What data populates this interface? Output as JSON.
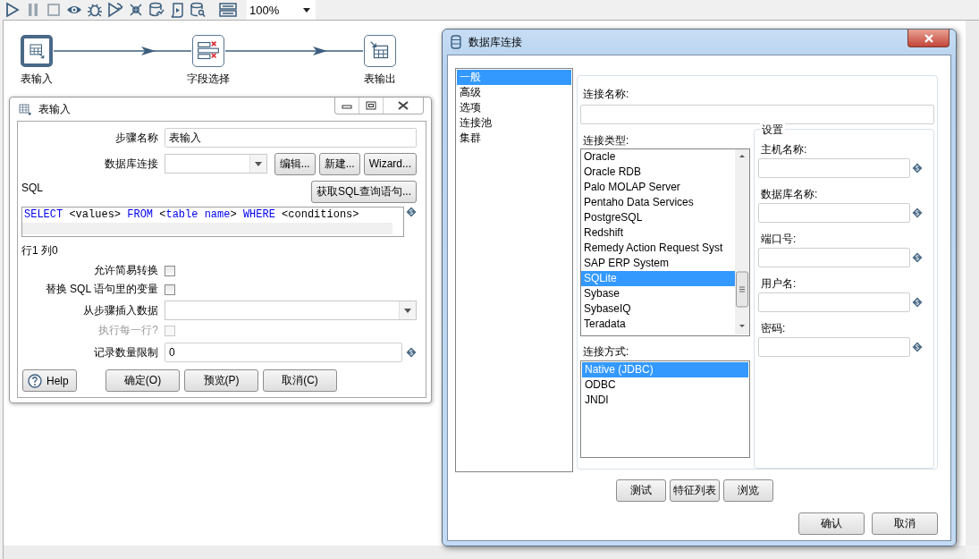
{
  "toolbar": {
    "zoom": "100%"
  },
  "flow": {
    "nodes": [
      {
        "label": "表输入",
        "selected": true,
        "kind": "input"
      },
      {
        "label": "字段选择",
        "selected": false,
        "kind": "select"
      },
      {
        "label": "表输出",
        "selected": false,
        "kind": "output"
      }
    ]
  },
  "step_dialog": {
    "title": "表输入",
    "step_name": {
      "label": "步骤名称",
      "value": "表输入"
    },
    "connection": {
      "label": "数据库连接",
      "buttons": [
        "编辑...",
        "新建...",
        "Wizard..."
      ]
    },
    "sql": {
      "label": "SQL",
      "button": "获取SQL查询语句...",
      "segments": [
        {
          "text": "SELECT",
          "kind": "keyword"
        },
        {
          "text": " <values> ",
          "kind": "plain"
        },
        {
          "text": "FROM",
          "kind": "keyword"
        },
        {
          "text": " <",
          "kind": "plain"
        },
        {
          "text": "table name",
          "kind": "keyword"
        },
        {
          "text": "> ",
          "kind": "plain"
        },
        {
          "text": "WHERE",
          "kind": "keyword"
        },
        {
          "text": " <conditions>",
          "kind": "plain"
        }
      ]
    },
    "position": "行1 列0",
    "options": [
      {
        "label": "允许简易转换",
        "checked": false,
        "disabled": false
      },
      {
        "label": "替换 SQL 语句里的变量",
        "checked": false,
        "disabled": false
      }
    ],
    "insert_from_step": {
      "label": "从步骤插入数据"
    },
    "execute_each_row": {
      "label": "执行每一行?",
      "checked": false,
      "disabled": true
    },
    "limit": {
      "label": "记录数量限制",
      "value": "0"
    },
    "buttons": [
      {
        "label": "Help",
        "kind": "help"
      },
      {
        "label": "确定(O)",
        "kind": "normal"
      },
      {
        "label": "预览(P)",
        "kind": "normal"
      },
      {
        "label": "取消(C)",
        "kind": "normal"
      }
    ]
  },
  "db_dialog": {
    "title": "数据库连接",
    "nav": [
      {
        "label": "一般",
        "selected": true
      },
      {
        "label": "高级",
        "selected": false
      },
      {
        "label": "选项",
        "selected": false
      },
      {
        "label": "连接池",
        "selected": false
      },
      {
        "label": "集群",
        "selected": false
      }
    ],
    "connection_name": {
      "label": "连接名称:"
    },
    "connection_type": {
      "label": "连接类型:",
      "items": [
        {
          "label": "Oracle",
          "selected": false
        },
        {
          "label": "Oracle RDB",
          "selected": false
        },
        {
          "label": "Palo MOLAP Server",
          "selected": false
        },
        {
          "label": "Pentaho Data Services",
          "selected": false
        },
        {
          "label": "PostgreSQL",
          "selected": false
        },
        {
          "label": "Redshift",
          "selected": false
        },
        {
          "label": "Remedy Action Request Syst",
          "selected": false
        },
        {
          "label": "SAP ERP System",
          "selected": false
        },
        {
          "label": "SQLite",
          "selected": true
        },
        {
          "label": "Sybase",
          "selected": false
        },
        {
          "label": "SybaseIQ",
          "selected": false
        },
        {
          "label": "Teradata",
          "selected": false
        }
      ]
    },
    "access": {
      "label": "连接方式:",
      "items": [
        {
          "label": "Native (JDBC)",
          "selected": true
        },
        {
          "label": "ODBC",
          "selected": false
        },
        {
          "label": "JNDI",
          "selected": false
        }
      ]
    },
    "settings": {
      "title": "设置",
      "fields": [
        {
          "label": "主机名称:"
        },
        {
          "label": "数据库名称:"
        },
        {
          "label": "端口号:"
        },
        {
          "label": "用户名:"
        },
        {
          "label": "密码:"
        }
      ]
    },
    "actions": [
      "测试",
      "特征列表",
      "浏览"
    ],
    "buttons": [
      "确认",
      "取消"
    ]
  }
}
